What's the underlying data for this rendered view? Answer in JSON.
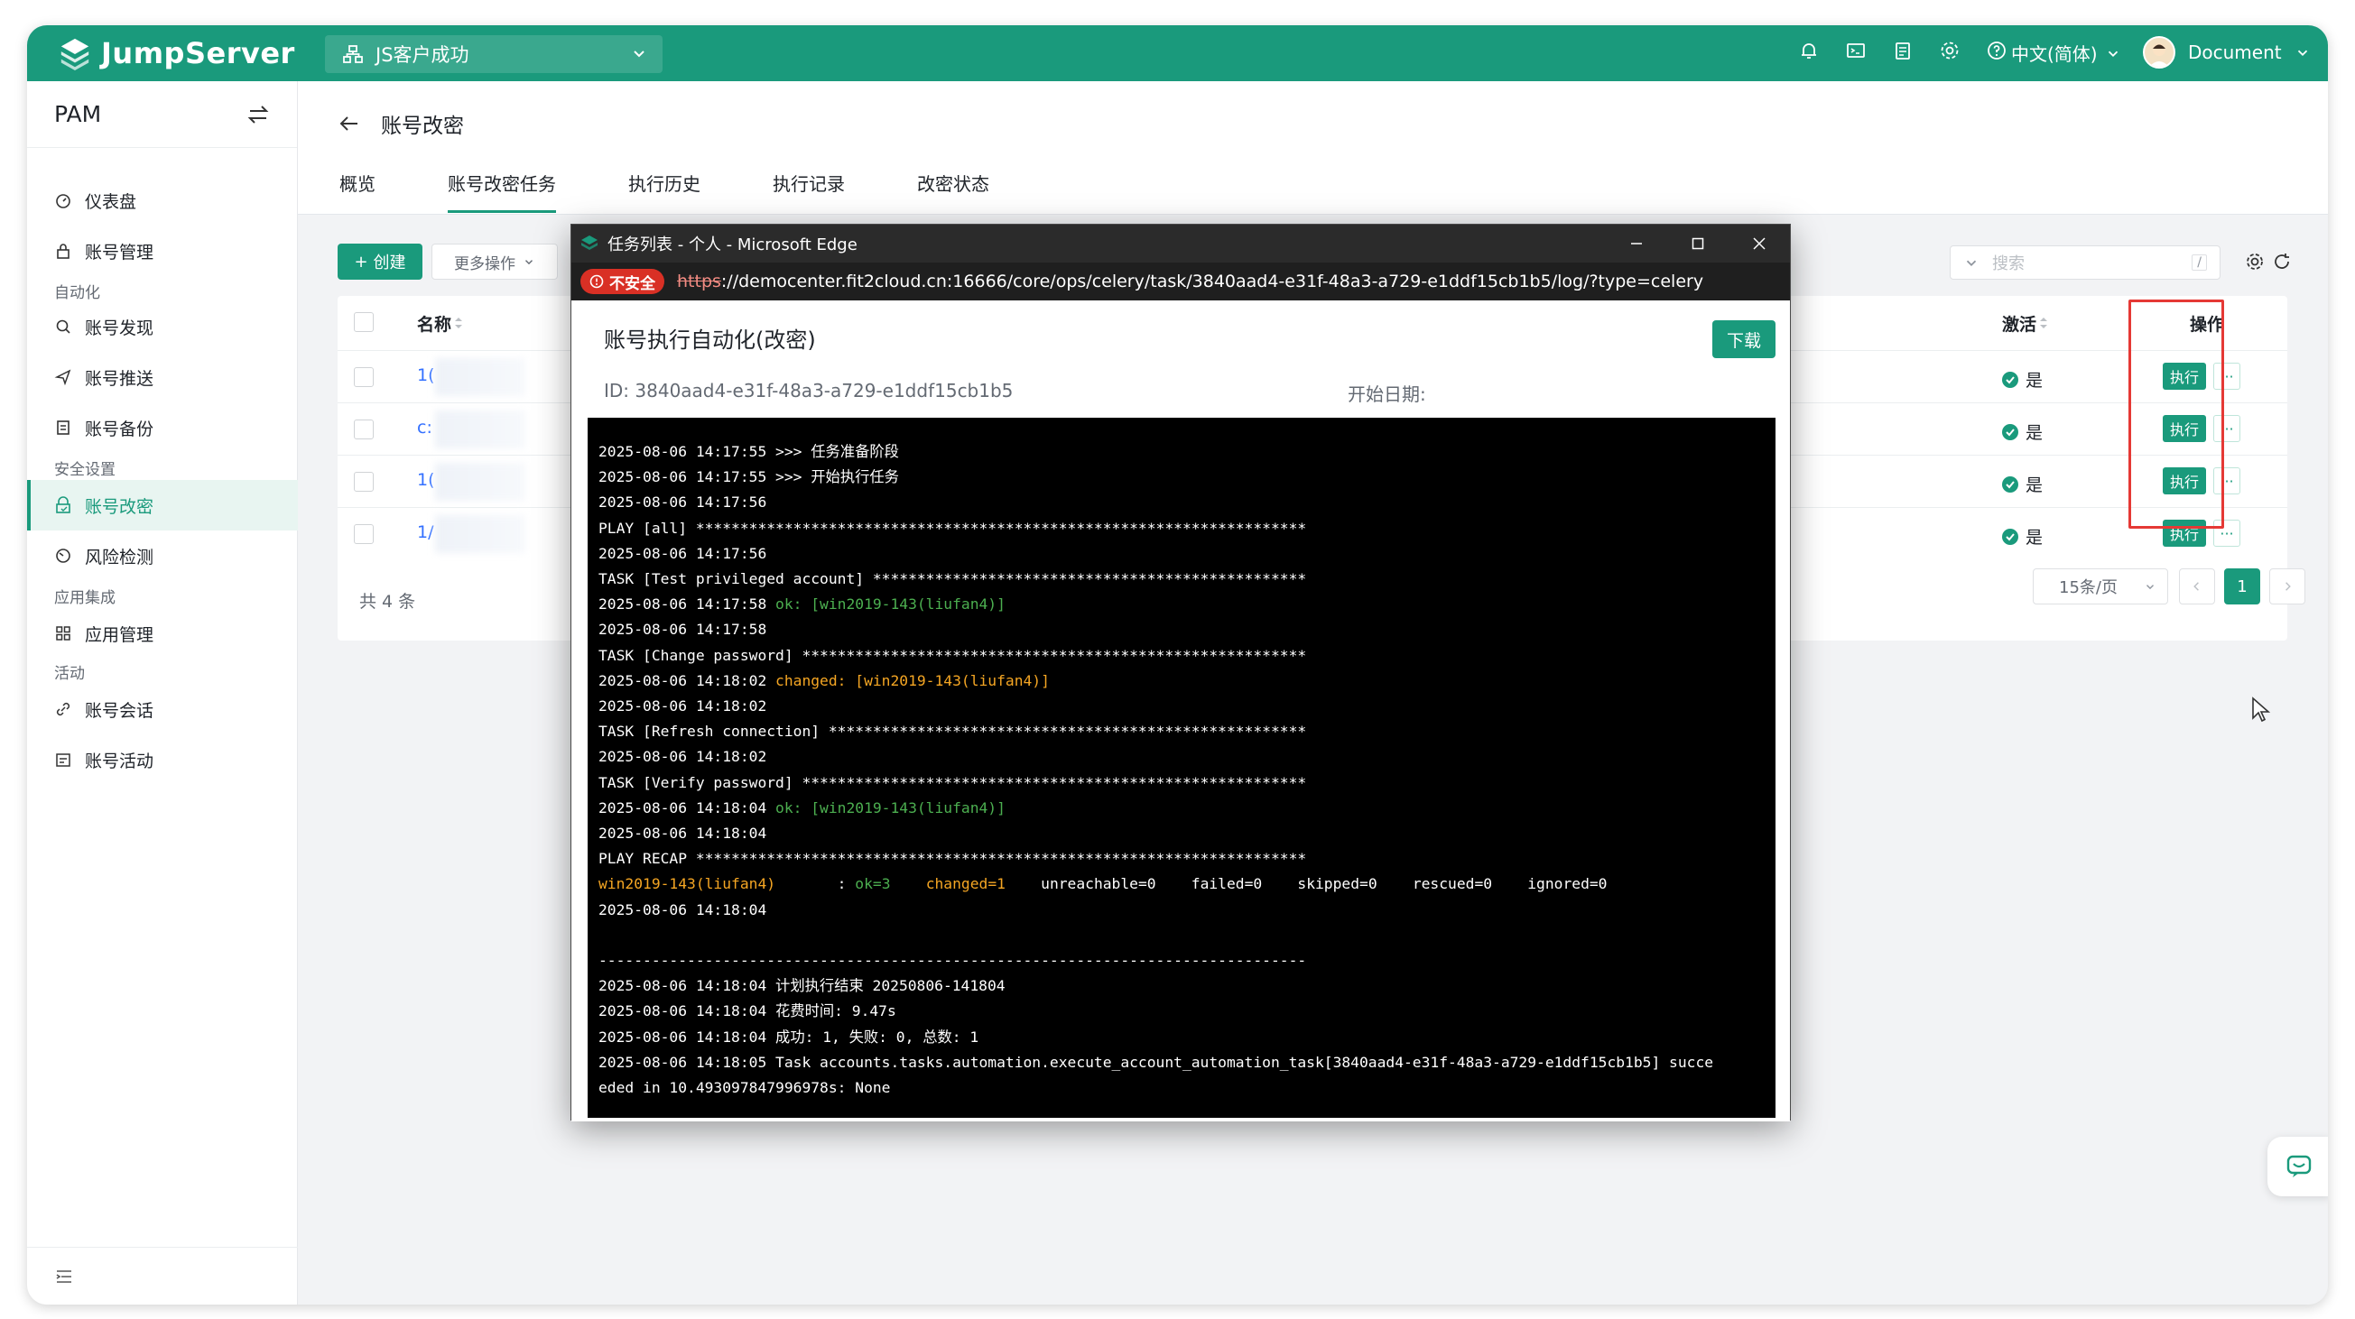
{
  "header": {
    "brand": "JumpServer",
    "org": "JS客户成功",
    "language": "中文(简体)",
    "user": "Document",
    "icons": [
      "bell-icon",
      "terminal-icon",
      "clipboard-icon",
      "gear-icon",
      "help-icon"
    ]
  },
  "sidebar": {
    "app": "PAM",
    "items": [
      {
        "label": "仪表盘"
      },
      {
        "label": "账号管理"
      },
      {
        "label": "账号发现"
      },
      {
        "label": "账号推送"
      },
      {
        "label": "账号备份"
      },
      {
        "label": "账号改密"
      },
      {
        "label": "风险检测"
      },
      {
        "label": "应用管理"
      },
      {
        "label": "账号会话"
      },
      {
        "label": "账号活动"
      }
    ],
    "groups": [
      "自动化",
      "安全设置",
      "应用集成",
      "活动"
    ]
  },
  "page": {
    "title": "账号改密",
    "tabs": [
      "概览",
      "账号改密任务",
      "执行历史",
      "执行记录",
      "改密状态"
    ],
    "create": "创建",
    "more": "更多操作",
    "search_placeholder": "搜索",
    "search_shortcut": "/"
  },
  "table": {
    "columns": {
      "name": "名称",
      "active": "激活",
      "actions": "操作"
    },
    "rows": [
      {
        "name": "1(",
        "active": "是",
        "exec": "执行"
      },
      {
        "name": "c:",
        "active": "是",
        "exec": "执行"
      },
      {
        "name": "1(",
        "active": "是",
        "exec": "执行"
      },
      {
        "name": "1/",
        "active": "是",
        "exec": "执行"
      }
    ],
    "total": "共 4 条",
    "page_size": "15条/页",
    "current_page": "1",
    "more_dots": "···"
  },
  "edge": {
    "window_title": "任务列表 - 个人 - Microsoft Edge",
    "insecure": "不安全",
    "url_scheme": "https",
    "url_rest": "://democenter.fit2cloud.cn:16666/core/ops/celery/task/3840aad4-e31f-48a3-a729-e1ddf15cb1b5/log/?type=celery",
    "job_title": "账号执行自动化(改密)",
    "download": "下载",
    "job_id": "ID: 3840aad4-e31f-48a3-a729-e1ddf15cb1b5",
    "start_date": "开始日期:"
  },
  "log": [
    {
      "t": "2025-08-06 14:17:55 >>> 任务准备阶段"
    },
    {
      "t": "2025-08-06 14:17:55 >>> 开始执行任务"
    },
    {
      "t": "2025-08-06 14:17:56"
    },
    {
      "t": "PLAY [all] *********************************************************************"
    },
    {
      "t": "2025-08-06 14:17:56"
    },
    {
      "t": "TASK [Test privileged account] *************************************************"
    },
    {
      "t": "2025-08-06 14:17:58 ",
      "c": "ok: [win2019-143(liufan4)]",
      "k": "ok"
    },
    {
      "t": "2025-08-06 14:17:58"
    },
    {
      "t": "TASK [Change password] *********************************************************"
    },
    {
      "t": "2025-08-06 14:18:02 ",
      "c": "changed: [win2019-143(liufan4)]",
      "k": "chg"
    },
    {
      "t": "2025-08-06 14:18:02"
    },
    {
      "t": "TASK [Refresh connection] ******************************************************"
    },
    {
      "t": "2025-08-06 14:18:02"
    },
    {
      "t": "TASK [Verify password] *********************************************************"
    },
    {
      "t": "2025-08-06 14:18:04 ",
      "c": "ok: [win2019-143(liufan4)]",
      "k": "ok"
    },
    {
      "t": "2025-08-06 14:18:04"
    },
    {
      "t": "PLAY RECAP *********************************************************************"
    },
    {
      "recap": true
    },
    {
      "t": "2025-08-06 14:18:04"
    },
    {
      "t": ""
    },
    {
      "t": "--------------------------------------------------------------------------------"
    },
    {
      "t": "2025-08-06 14:18:04 计划执行结束 20250806-141804"
    },
    {
      "t": "2025-08-06 14:18:04 花费时间: 9.47s"
    },
    {
      "t": "2025-08-06 14:18:04 成功: 1, 失败: 0, 总数: 1"
    },
    {
      "t": "2025-08-06 14:18:05 Task accounts.tasks.automation.execute_account_automation_task[3840aad4-e31f-48a3-a729-e1ddf15cb1b5] succe"
    },
    {
      "t": "eded in 10.493097847996978s: None"
    }
  ],
  "recap": {
    "host": "win2019-143(liufan4)",
    "sep": "       : ",
    "ok": "ok=3",
    "changed": "changed=1",
    "rest": "unreachable=0    failed=0    skipped=0    rescued=0    ignored=0"
  },
  "colors": {
    "accent": "#1a9a7c",
    "link": "#3370ff",
    "danger": "#d93025",
    "ok": "#4caf50",
    "changed": "#f5a623"
  }
}
